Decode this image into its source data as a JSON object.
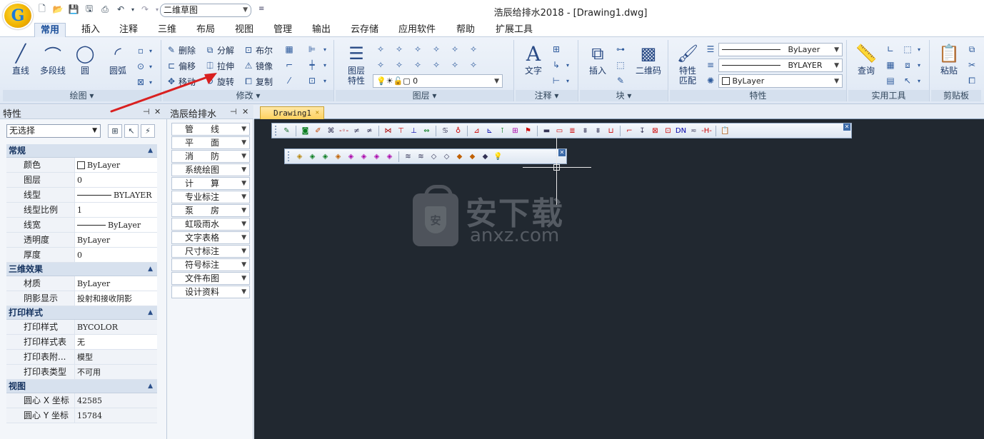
{
  "app": {
    "window_title": "浩辰给排水2018 - [Drawing1.dwg]",
    "logo_letter": "G",
    "workspace": "二维草图"
  },
  "ribbon_tabs": [
    "常用",
    "插入",
    "注释",
    "三维",
    "布局",
    "视图",
    "管理",
    "输出",
    "云存储",
    "应用软件",
    "帮助",
    "扩展工具"
  ],
  "ribbon": {
    "draw": {
      "title": "绘图",
      "buttons": [
        "直线",
        "多段线",
        "圆",
        "圆弧"
      ]
    },
    "modify": {
      "title": "修改",
      "buttons": [
        "删除",
        "分解",
        "布尔",
        "偏移",
        "拉伸",
        "镜像",
        "移动",
        "旋转",
        "复制"
      ]
    },
    "layer": {
      "title": "图层",
      "big_line1": "图层",
      "big_line2": "特性",
      "current_layer": "0"
    },
    "annotation": {
      "title": "注释",
      "text_label": "文字"
    },
    "block": {
      "title": "块",
      "insert_label": "插入",
      "qrcode_label": "二维码"
    },
    "properties": {
      "title": "特性",
      "match_line1": "特性",
      "match_line2": "匹配",
      "linetype": "ByLayer",
      "lineweight": "BYLAYER",
      "color": "ByLayer"
    },
    "utilities": {
      "title": "实用工具",
      "query_label": "查询"
    },
    "clipboard": {
      "title": "剪贴板",
      "paste_label": "粘贴"
    }
  },
  "properties_palette": {
    "title": "特性",
    "selection": "无选择",
    "categories": [
      {
        "name": "常规",
        "rows": [
          {
            "key": "颜色",
            "value": "ByLayer"
          },
          {
            "key": "图层",
            "value": "0"
          },
          {
            "key": "线型",
            "value": "BYLAYER"
          },
          {
            "key": "线型比例",
            "value": "1"
          },
          {
            "key": "线宽",
            "value": "ByLayer"
          },
          {
            "key": "透明度",
            "value": "ByLayer"
          },
          {
            "key": "厚度",
            "value": "0"
          }
        ]
      },
      {
        "name": "三维效果",
        "rows": [
          {
            "key": "材质",
            "value": "ByLayer"
          },
          {
            "key": "阴影显示",
            "value": "投射和接收阴影"
          }
        ]
      },
      {
        "name": "打印样式",
        "rows": [
          {
            "key": "打印样式",
            "value": "BYCOLOR"
          },
          {
            "key": "打印样式表",
            "value": "无"
          },
          {
            "key": "打印表附...",
            "value": "模型"
          },
          {
            "key": "打印表类型",
            "value": "不可用"
          }
        ]
      },
      {
        "name": "视图",
        "rows": [
          {
            "key": "圆心 X 坐标",
            "value": "42585"
          },
          {
            "key": "圆心 Y 坐标",
            "value": "15784"
          }
        ]
      }
    ]
  },
  "plugin_panel": {
    "title": "浩辰给排水",
    "items": [
      "管　　线",
      "平　　面",
      "消　　防",
      "系统绘图",
      "计　　算",
      "专业标注",
      "泵　　房",
      "虹吸雨水",
      "文字表格",
      "尺寸标注",
      "符号标注",
      "文件布图",
      "设计资料"
    ]
  },
  "document": {
    "tab": "Drawing1"
  },
  "watermark": {
    "cn": "安下载",
    "en": "anxz.com",
    "shield_char": "安"
  },
  "colors": {
    "canvas": "#212830",
    "accent": "#1a4e9a",
    "doc_tab": "#ffd15e",
    "annotation_arrow": "#d92020"
  }
}
